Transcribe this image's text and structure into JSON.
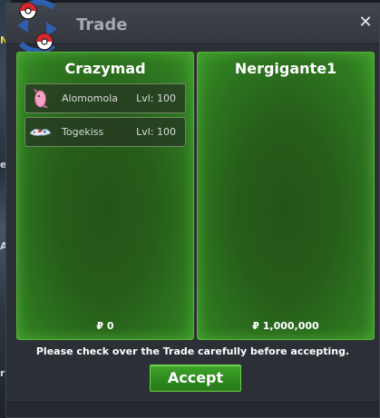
{
  "window": {
    "title": "Trade"
  },
  "background": {
    "side_letters": [
      "N",
      "e",
      "A",
      "r"
    ]
  },
  "left_panel": {
    "player": "Crazymad",
    "money": "₽ 0",
    "slots": [
      {
        "pokemon": "Alomomola",
        "level": "Lvl: 100",
        "icon": "alomomola-icon"
      },
      {
        "pokemon": "Togekiss",
        "level": "Lvl: 100",
        "icon": "togekiss-icon"
      }
    ]
  },
  "right_panel": {
    "player": "Nergigante1",
    "money": "₽ 1,000,000"
  },
  "footer": {
    "notice": "Please check over the Trade carefully before accepting.",
    "accept_label": "Accept"
  },
  "colors": {
    "panel_green": "#2f7a20",
    "panel_border": "#58b338",
    "accept_green": "#3fa72a",
    "window_bg": "#2b2f36"
  }
}
